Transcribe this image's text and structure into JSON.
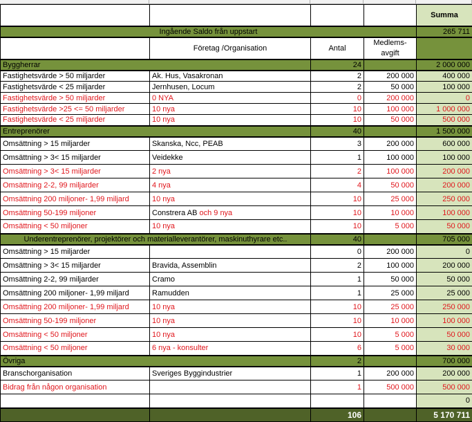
{
  "colors": {
    "section": "#76923c",
    "sum": "#d7e4bc",
    "total": "#4f6228",
    "red": "#e0161c"
  },
  "summa_label": "Summa",
  "opening": {
    "label": "Ingående Saldo från uppstart",
    "sum": "265 711"
  },
  "headers": {
    "org": "Företag /Organisation",
    "antal": "Antal",
    "fee": "Medlems-\navgift"
  },
  "sections": [
    {
      "label": "Byggherrar",
      "antal": "24",
      "sum": "2 000 000",
      "rows": [
        {
          "cat": "Fastighetsvärde > 50 miljarder",
          "org": "Ak. Hus,  Vasakronan",
          "antal": "2",
          "fee": "200 000",
          "sum": "400 000",
          "red": false
        },
        {
          "cat": "Fastighetsvärde < 25 miljarder",
          "org": " Jernhusen, Locum",
          "antal": "2",
          "fee": "50 000",
          "sum": "100 000",
          "red": false
        },
        {
          "cat": "Fastighetsvärde > 50 miljarder",
          "org": "0 NYA",
          "antal": "0",
          "fee": "200 000",
          "sum": "0",
          "red": true
        },
        {
          "cat": "Fastighetsvärde >25 <= 50 miljarder",
          "org": "10 nya",
          "antal": "10",
          "fee": "100 000",
          "sum": "1 000 000",
          "red": true
        },
        {
          "cat": "Fastighetsvärde < 25 miljarder",
          "org": "10  nya",
          "antal": "10",
          "fee": "50 000",
          "sum": "500 000",
          "red": true
        }
      ]
    },
    {
      "label": "Entreprenörer",
      "antal": "40",
      "sum": "1 500 000",
      "rows": [
        {
          "cat": "Omsättning > 15 miljarder",
          "org": "Skanska, Ncc, PEAB",
          "antal": "3",
          "fee": "200 000",
          "sum": "600 000",
          "red": false
        },
        {
          "cat": "Omsättning > 3< 15 miljarder",
          "org": "Veidekke",
          "antal": "1",
          "fee": "100 000",
          "sum": "100 000",
          "red": false
        },
        {
          "cat": "Omsättning > 3< 15 miljarder",
          "org": "2 nya",
          "antal": "2",
          "fee": "100 000",
          "sum": "200 000",
          "red": true
        },
        {
          "cat": "Omsättning 2-2, 99 miljarder",
          "org": "4 nya",
          "antal": "4",
          "fee": "50 000",
          "sum": "200 000",
          "red": true
        },
        {
          "cat": "Omsättning 200 miljoner- 1,99 miljard",
          "org": "10 nya",
          "antal": "10",
          "fee": "25 000",
          "sum": "250 000",
          "red": true
        },
        {
          "cat": "Omsättning 50-199 miljoner",
          "org": "Constrera AB",
          "org_red": " och 9 nya",
          "antal": "10",
          "fee": "10 000",
          "sum": "100 000",
          "red": true
        },
        {
          "cat": "Omsättning < 50 miljoner",
          "org": "10 nya",
          "antal": "10",
          "fee": "5 000",
          "sum": "50 000",
          "red": true
        }
      ]
    },
    {
      "label": "Underentreprenörer, projektörer och materialleverantörer, maskinuthyrare etc..",
      "antal": "40",
      "sum": "705 000",
      "centered": true,
      "rows": [
        {
          "cat": "Omsättning > 15 miljarder",
          "org": "",
          "antal": "0",
          "fee": "200 000",
          "sum": "0",
          "red": false
        },
        {
          "cat": "Omsättning > 3< 15 miljarder",
          "org": "Bravida, Assemblin",
          "antal": "2",
          "fee": "100 000",
          "sum": "200 000",
          "red": false
        },
        {
          "cat": "Omsättning 2-2, 99 miljarder",
          "org": "Cramo",
          "antal": "1",
          "fee": "50 000",
          "sum": "50 000",
          "red": false
        },
        {
          "cat": "Omsättning 200 miljoner- 1,99 miljard",
          "org": "Ramudden",
          "antal": "1",
          "fee": "25 000",
          "sum": "25 000",
          "red": false
        },
        {
          "cat": "Omsättning 200 miljoner- 1,99 miljard",
          "org": "10 nya",
          "antal": "10",
          "fee": "25 000",
          "sum": "250 000",
          "red": true
        },
        {
          "cat": "Omsättning 50-199 miljoner",
          "org": "10 nya",
          "antal": "10",
          "fee": "10 000",
          "sum": "100 000",
          "red": true
        },
        {
          "cat": "Omsättning < 50 miljoner",
          "org": "10 nya",
          "antal": "10",
          "fee": "5 000",
          "sum": "50 000",
          "red": true
        },
        {
          "cat": "Omsättning < 50 miljoner",
          "org": "6 nya - konsulter",
          "antal": "6",
          "fee": "5 000",
          "sum": "30 000",
          "red": true
        }
      ]
    },
    {
      "label": "Övriga",
      "antal": "2",
      "sum": "700 000",
      "rows": [
        {
          "cat": "Branschorganisation",
          "org": "Sveriges Byggindustrier",
          "antal": "1",
          "fee": "200 000",
          "sum": "200 000",
          "red": false
        },
        {
          "cat": "Bidrag från någon organisation",
          "org": "",
          "antal": "1",
          "fee": "500 000",
          "sum": "500 000",
          "red": true
        },
        {
          "cat": "",
          "org": "",
          "antal": "",
          "fee": "",
          "sum": "0",
          "red": false
        }
      ]
    }
  ],
  "total": {
    "antal": "106",
    "sum": "5 170 711"
  }
}
